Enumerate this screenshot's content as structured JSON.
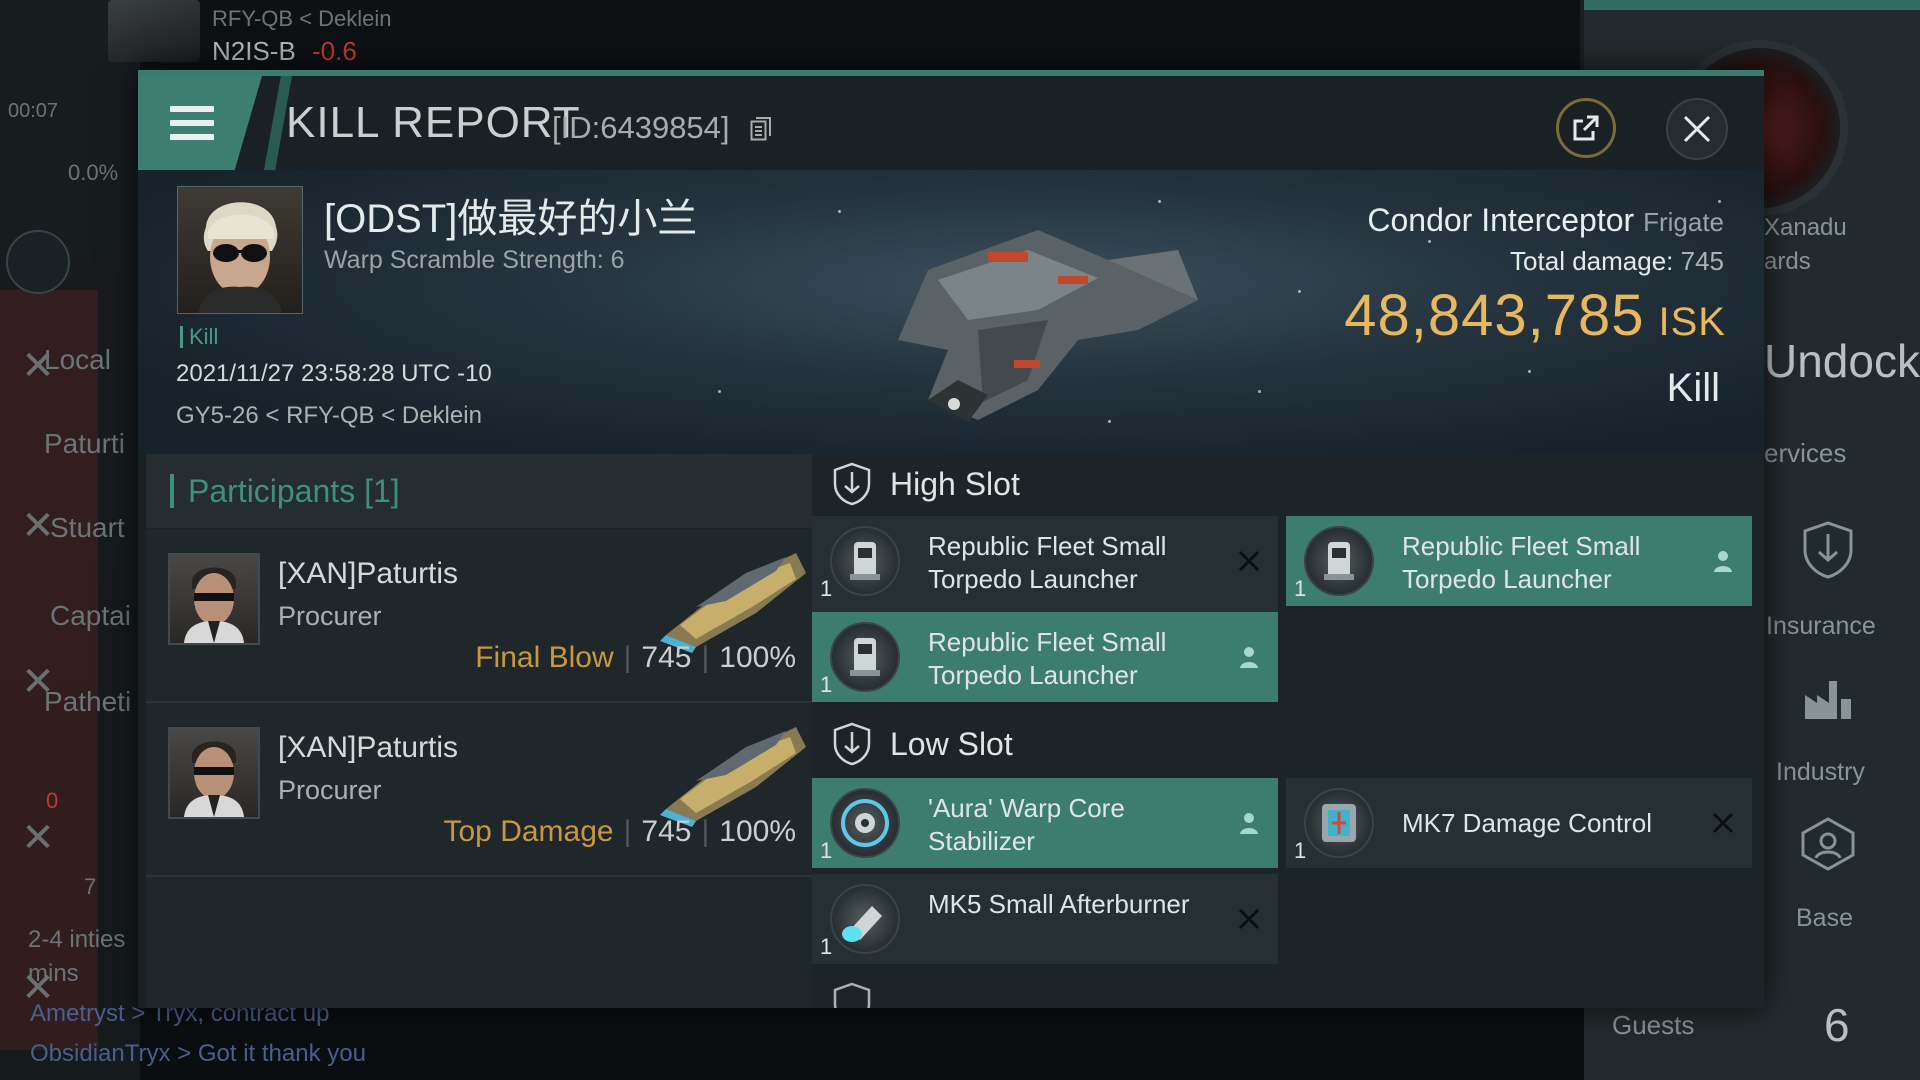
{
  "background": {
    "top_system_path": "RFY-QB < Deklein",
    "top_system": "N2IS-B",
    "top_security": "-0.6",
    "clock": "00:07",
    "cargo_pct": "0.0%",
    "left_panel_items": [
      "Local",
      "Paturti",
      "Stuart",
      "Captai",
      "Patheti"
    ],
    "left_counter_red": "0",
    "left_counter": "7",
    "left_status_line1": "2-4 inties",
    "left_status_line2": "mins",
    "chat": [
      {
        "author": "Ametryst",
        "message": "Tryx, contract up"
      },
      {
        "author": "ObsidianTryx",
        "message": "Got it thank you"
      }
    ],
    "right_panel": {
      "station_name": "Xanadu",
      "station_sub": "ards",
      "undock_label": "Undock",
      "services_label": "ervices",
      "guests_label": "Guests",
      "guests_count": "6",
      "side_buttons": [
        {
          "label": "Insurance",
          "icon": "shield-icon"
        },
        {
          "label": "Industry",
          "icon": "factory-icon"
        },
        {
          "label": "Base",
          "icon": "base-icon"
        }
      ]
    }
  },
  "modal": {
    "title": "KILL REPORT",
    "report_id": "[ID:6439854]",
    "victim": {
      "name": "[ODST]做最好的小兰",
      "warp_scramble": "Warp Scramble Strength: 6",
      "kill_tag": "Kill",
      "timestamp": "2021/11/27 23:58:28 UTC -10",
      "location": "GY5-26 < RFY-QB < Deklein"
    },
    "ship": {
      "name": "Condor Interceptor",
      "class": "Frigate",
      "total_damage_label": "Total damage:",
      "total_damage_value": "745",
      "isk_value": "48,843,785",
      "isk_unit": "ISK",
      "result": "Kill"
    },
    "participants": {
      "header": "Participants [1]",
      "items": [
        {
          "name": "[XAN]Paturtis",
          "ship": "Procurer",
          "tag": "Final Blow",
          "damage": "745",
          "percent": "100%"
        },
        {
          "name": "[XAN]Paturtis",
          "ship": "Procurer",
          "tag": "Top Damage",
          "damage": "745",
          "percent": "100%"
        }
      ]
    },
    "fitting": {
      "high_slot_label": "High Slot",
      "low_slot_label": "Low Slot",
      "high_slot": [
        {
          "name": "Republic Fleet Small Torpedo Launcher",
          "qty": "1",
          "status": "destroyed"
        },
        {
          "name": "Republic Fleet Small Torpedo Launcher",
          "qty": "1",
          "status": "dropped"
        },
        {
          "name": "Republic Fleet Small Torpedo Launcher",
          "qty": "1",
          "status": "dropped"
        }
      ],
      "low_slot": [
        {
          "name": "'Aura' Warp Core Stabilizer",
          "qty": "1",
          "status": "dropped"
        },
        {
          "name": "MK7 Damage Control",
          "qty": "1",
          "status": "destroyed"
        },
        {
          "name": "MK5 Small Afterburner",
          "qty": "1",
          "status": "destroyed"
        }
      ]
    }
  },
  "colors": {
    "accent": "#3c7d70",
    "isk": "#e8b860",
    "tag": "#c9973f"
  }
}
